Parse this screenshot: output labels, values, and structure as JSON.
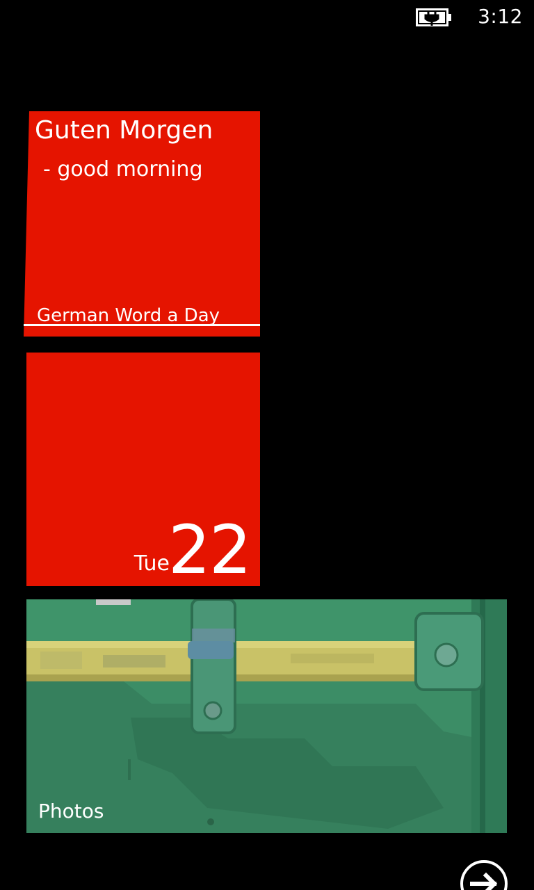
{
  "status_bar": {
    "time": "3:12",
    "battery_icon": "battery-charging-icon"
  },
  "tiles": {
    "word_of_day": {
      "word": "Guten Morgen",
      "translation": "- good morning",
      "app_name": "German Word a Day",
      "color": "#e51400"
    },
    "calendar": {
      "weekday": "Tue",
      "day": "22",
      "color": "#e51400"
    },
    "photos": {
      "label": "Photos",
      "color": "#3a8a64"
    }
  },
  "navigation": {
    "all_apps_icon": "arrow-right-circle-icon"
  }
}
